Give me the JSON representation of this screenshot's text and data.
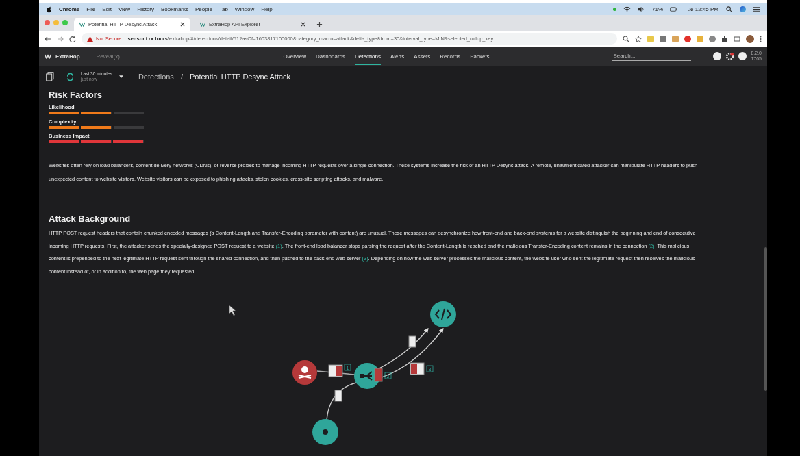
{
  "menu_bar": {
    "app": "Chrome",
    "items": [
      "File",
      "Edit",
      "View",
      "History",
      "Bookmarks",
      "People",
      "Tab",
      "Window",
      "Help"
    ],
    "battery": "71%",
    "clock": "Tue 12:45 PM"
  },
  "tabs": [
    {
      "label": "Potential HTTP Desync Attack",
      "selected": true
    },
    {
      "label": "ExtraHop API Explorer",
      "selected": false
    }
  ],
  "address_bar": {
    "security": "Not Secure",
    "domain": "sensor.i.rx.tours",
    "path": "/extrahop/#/detections/detail/51?asOf=1603817100000&category_macro=attack&delta_type&from=30&interval_type=MIN&selected_rollup_key..."
  },
  "app_nav": {
    "logo": "ExtraHop",
    "product": "Reveal(x)",
    "items": [
      {
        "label": "Overview",
        "selected": false
      },
      {
        "label": "Dashboards",
        "selected": false
      },
      {
        "label": "Detections",
        "selected": true
      },
      {
        "label": "Alerts",
        "selected": false
      },
      {
        "label": "Assets",
        "selected": false
      },
      {
        "label": "Records",
        "selected": false
      },
      {
        "label": "Packets",
        "selected": false
      }
    ],
    "search": {
      "placeholder": "Search..."
    },
    "version": [
      "8.2.0",
      "1705"
    ]
  },
  "toolbar": {
    "time_range": "Last 30 minutes",
    "time_sub": "just now",
    "breadcrumb": [
      "Detections",
      "/",
      "Potential HTTP Desync Attack"
    ]
  },
  "risk_factors": {
    "title": "Risk Factors",
    "factors": [
      {
        "label": "Likelihood",
        "level": 0.67,
        "color": "#f07a1a"
      },
      {
        "label": "Complexity",
        "level": 0.67,
        "color": "#f07a1a"
      },
      {
        "label": "Business Impact",
        "level": 1,
        "color": "#e0363a"
      }
    ]
  },
  "summary": "Websites often rely on load balancers, content delivery networks (CDNs), or reverse proxies to manage incoming HTTP requests over a single connection. These systems increase the risk of an HTTP Desync attack. A remote, unauthenticated attacker can manipulate HTTP headers to push unexpected content to website visitors. Website visitors can be exposed to phishing attacks, stolen cookies, cross-site scripting attacks, and malware.",
  "attack_background": {
    "title": "Attack Background",
    "parts": [
      {
        "kind": "text",
        "text": "HTTP POST request headers that contain chunked encoded messages (a Content-Length and Transfer-Encoding parameter with content) are unusual. These messages can desynchronize how front-end and back-end systems for a website distinguish the beginning and end of consecutive incoming HTTP requests. First, the attacker sends the specially-designed POST request to a website "
      },
      {
        "kind": "link",
        "text": "(1)"
      },
      {
        "kind": "text",
        "text": ". The front-end load balancer stops parsing the request after the Content-Length is reached and the malicious Transfer-Encoding content remains in the connection "
      },
      {
        "kind": "link",
        "text": "(2)"
      },
      {
        "kind": "text",
        "text": ". This malicious content is prepended to the next legitimate HTTP request sent through the shared connection, and then pushed to the back-end web server "
      },
      {
        "kind": "link",
        "text": "(3)"
      },
      {
        "kind": "text",
        "text": ". Depending on how the web server processes the malicious content, the website user who sent the legitimate request then receives the malicious content instead of, or in addition to, the web page they requested."
      }
    ]
  },
  "diagram": {
    "steps": [
      "1",
      "2",
      "3"
    ]
  }
}
